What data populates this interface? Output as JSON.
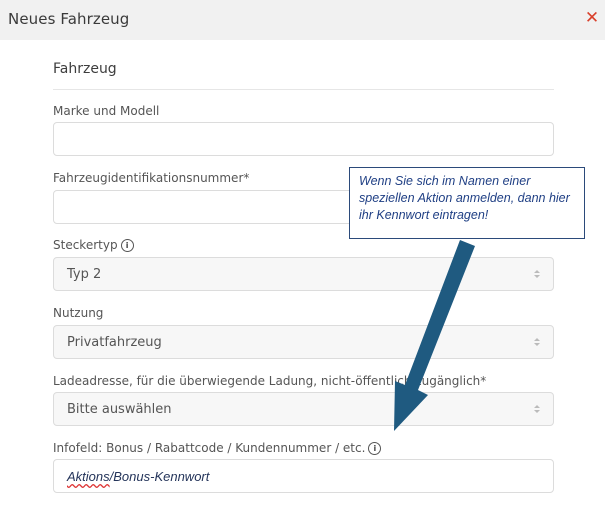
{
  "dialog": {
    "title": "Neues Fahrzeug",
    "close_icon": "close-icon",
    "close_color": "#d9402b"
  },
  "section": {
    "title": "Fahrzeug"
  },
  "fields": {
    "model": {
      "label": "Marke und Modell",
      "value": ""
    },
    "vin": {
      "label": "Fahrzeugidentifikationsnummer*",
      "value": ""
    },
    "plug": {
      "label": "Steckertyp",
      "info_icon": "info-icon",
      "value": "Typ 2"
    },
    "usage": {
      "label": "Nutzung",
      "value": "Privatfahrzeug"
    },
    "address": {
      "label": "Ladeadresse, für die überwiegende Ladung, nicht-öffentlich zugänglich*",
      "value": "Bitte auswählen"
    },
    "infofield": {
      "label": "Infofeld: Bonus / Rabattcode / Kundennummer / etc.",
      "info_icon": "info-icon",
      "value_underlined": "Aktions",
      "value_rest": "/Bonus-Kennwort"
    }
  },
  "annotation": {
    "text": "Wenn Sie sich im Namen einer speziellen Aktion anmelden, dann hier ihr Kennwort eintragen!",
    "arrow_color": "#1f5a80",
    "text_color": "#1f3f84"
  }
}
